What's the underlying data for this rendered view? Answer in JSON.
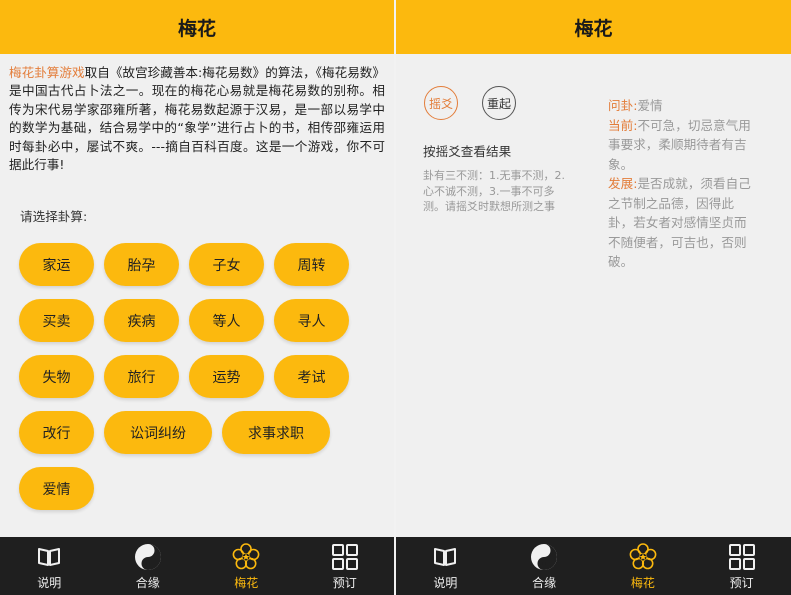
{
  "app": {
    "title": "梅花",
    "accent_color": "#fcb90e",
    "highlight_color": "#e37d3a",
    "tabbar_bg": "#1f1f1f"
  },
  "tabbar": {
    "items": [
      {
        "label": "说明",
        "icon": "book-icon",
        "active": false
      },
      {
        "label": "合缘",
        "icon": "yin-yang-icon",
        "active": false
      },
      {
        "label": "梅花",
        "icon": "plum-blossom-icon",
        "active": true
      },
      {
        "label": "预订",
        "icon": "grid-icon",
        "active": false
      }
    ]
  },
  "left": {
    "intro": {
      "highlight": "梅花卦算游戏",
      "text": "取自《故宫珍藏善本:梅花易数》的算法，《梅花易数》是中国古代占卜法之一。现在的梅花心易就是梅花易数的别称。相传为宋代易学家邵雍所著，梅花易数起源于汉易，是一部以易学中的数学为基础，结合易学中的“象学”进行占卜的书，相传邵雍运用时每卦必中，屡试不爽。---摘自百科百度。这是一个游戏，你不可据此行事!"
    },
    "prompt": "请选择卦算:",
    "buttons": {
      "row1": [
        "家运",
        "胎孕",
        "子女",
        "周转"
      ],
      "row2": [
        "买卖",
        "疾病",
        "等人",
        "寻人"
      ],
      "row3": [
        "失物",
        "旅行",
        "运势",
        "考试"
      ],
      "row4": [
        "改行",
        "讼词纠纷",
        "求事求职"
      ],
      "row5": [
        "爱情"
      ]
    }
  },
  "right": {
    "shake_label": "摇爻",
    "reset_label": "重起",
    "hint_title": "按摇爻查看结果",
    "hint_text": "卦有三不测：1.无事不测，2.心不诚不测，3.一事不可多测。请摇爻时默想所测之事",
    "result": {
      "question_key": "问卦:",
      "question_value": "爱情",
      "current_key": "当前:",
      "current_value": "不可急，切忌意气用事要求，柔顺期待者有吉象。",
      "development_key": "发展:",
      "development_value": "是否成就，须看自己之节制之品德，因得此卦，若女者对感情坚贞而不随便者，可吉也，否则破。"
    }
  }
}
